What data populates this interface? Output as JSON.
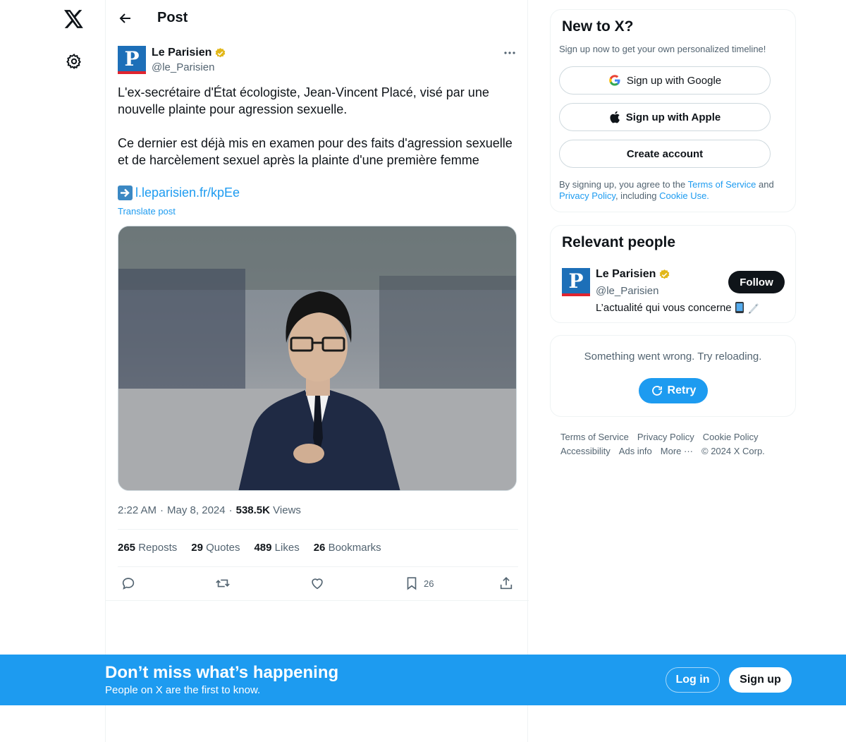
{
  "header": {
    "title": "Post"
  },
  "post": {
    "author_name": "Le Parisien",
    "author_handle": "@le_Parisien",
    "avatar_letter": "P",
    "text_paragraph_1": "L'ex-secrétaire d'État écologiste, Jean-Vincent Placé, visé par une nouvelle plainte pour agression sexuelle.",
    "text_paragraph_2": "Ce dernier est déjà mis en examen pour des faits d'agression sexuelle et de harcèlement sexuel après la plainte d'une première femme",
    "link_text": "l.leparisien.fr/kpEe",
    "translate_label": "Translate post",
    "time": "2:22 AM",
    "date": "May 8, 2024",
    "views_count": "538.5K",
    "views_label": "Views",
    "reposts_count": "265",
    "reposts_label": "Reposts",
    "quotes_count": "29",
    "quotes_label": "Quotes",
    "likes_count": "489",
    "likes_label": "Likes",
    "bookmarks_count": "26",
    "bookmarks_label": "Bookmarks",
    "bookmark_action_count": "26"
  },
  "signup_card": {
    "title": "New to X?",
    "subtitle": "Sign up now to get your own personalized timeline!",
    "google_label": "Sign up with Google",
    "apple_label": "Sign up with Apple",
    "create_label": "Create account",
    "legal_prefix": "By signing up, you agree to the ",
    "terms_link": "Terms of Service",
    "legal_and": " and",
    "privacy_link": "Privacy Policy",
    "legal_including": ", including ",
    "cookie_link": "Cookie Use."
  },
  "relevant_people": {
    "title": "Relevant people",
    "name": "Le Parisien",
    "handle": "@le_Parisien",
    "bio": "L’actualité qui vous concerne",
    "follow_label": "Follow"
  },
  "trends_error": {
    "message": "Something went wrong. Try reloading.",
    "retry_label": "Retry"
  },
  "footer": {
    "terms": "Terms of Service",
    "privacy": "Privacy Policy",
    "cookie": "Cookie Policy",
    "accessibility": "Accessibility",
    "ads": "Ads info",
    "more": "More ···",
    "copyright": "© 2024 X Corp."
  },
  "banner": {
    "title": "Don’t miss what’s happening",
    "subtitle": "People on X are the first to know.",
    "login_label": "Log in",
    "signup_label": "Sign up"
  },
  "colors": {
    "accent": "#1d9bf0",
    "verified_gold": "#e2b719",
    "avatar_blue": "#1d6fb8",
    "avatar_red": "#e0242f"
  }
}
